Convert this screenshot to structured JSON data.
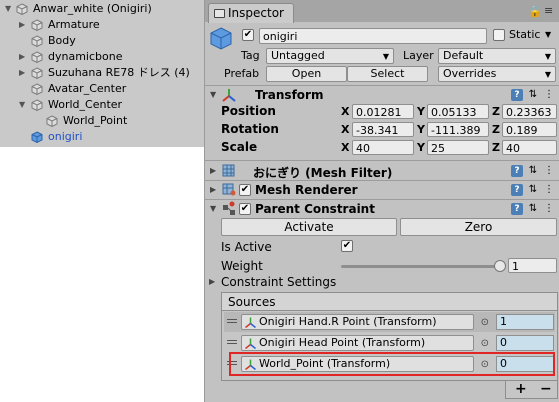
{
  "hierarchy": {
    "items": [
      {
        "label": "Anwar_white (Onigiri)"
      },
      {
        "label": "Armature"
      },
      {
        "label": "Body"
      },
      {
        "label": "dynamicbone"
      },
      {
        "label": "Suzuhana RE78 ドレス (4)"
      },
      {
        "label": "Avatar_Center"
      },
      {
        "label": "World_Center"
      },
      {
        "label": "World_Point"
      },
      {
        "label": "onigiri"
      }
    ]
  },
  "inspector": {
    "tab_label": "Inspector",
    "object": {
      "name": "onigiri",
      "static_label": "Static",
      "tag_label": "Tag",
      "tag_value": "Untagged",
      "layer_label": "Layer",
      "layer_value": "Default",
      "prefab_label": "Prefab",
      "open_label": "Open",
      "select_label": "Select",
      "overrides_label": "Overrides"
    },
    "transform": {
      "title": "Transform",
      "position_label": "Position",
      "rotation_label": "Rotation",
      "scale_label": "Scale",
      "x": "X",
      "y": "Y",
      "z": "Z",
      "position": [
        "0.01281",
        "0.05133",
        "0.23363"
      ],
      "rotation": [
        "-38.341",
        "-111.389",
        "0.189"
      ],
      "scale": [
        "40",
        "25",
        "40"
      ]
    },
    "mesh_filter": {
      "title": "おにぎり (Mesh Filter)"
    },
    "mesh_renderer": {
      "title": "Mesh Renderer"
    },
    "parent_constraint": {
      "title": "Parent Constraint",
      "activate_label": "Activate",
      "zero_label": "Zero",
      "is_active_label": "Is Active",
      "weight_label": "Weight",
      "weight_value": "1",
      "constraint_settings_label": "Constraint Settings",
      "sources_label": "Sources",
      "sources": [
        {
          "name": "Onigiri Hand.R Point (Transform)",
          "weight": "1"
        },
        {
          "name": "Onigiri Head Point (Transform)",
          "weight": "0"
        },
        {
          "name": "World_Point (Transform)",
          "weight": "0"
        }
      ],
      "add_label": "+",
      "remove_label": "−"
    }
  },
  "colors": {
    "highlight": "#e02525",
    "selected_text": "#1f50c8",
    "transform_axis_red": "#d03a2a",
    "transform_axis_green": "#3aa53a",
    "transform_axis_blue": "#2a5fd0"
  }
}
